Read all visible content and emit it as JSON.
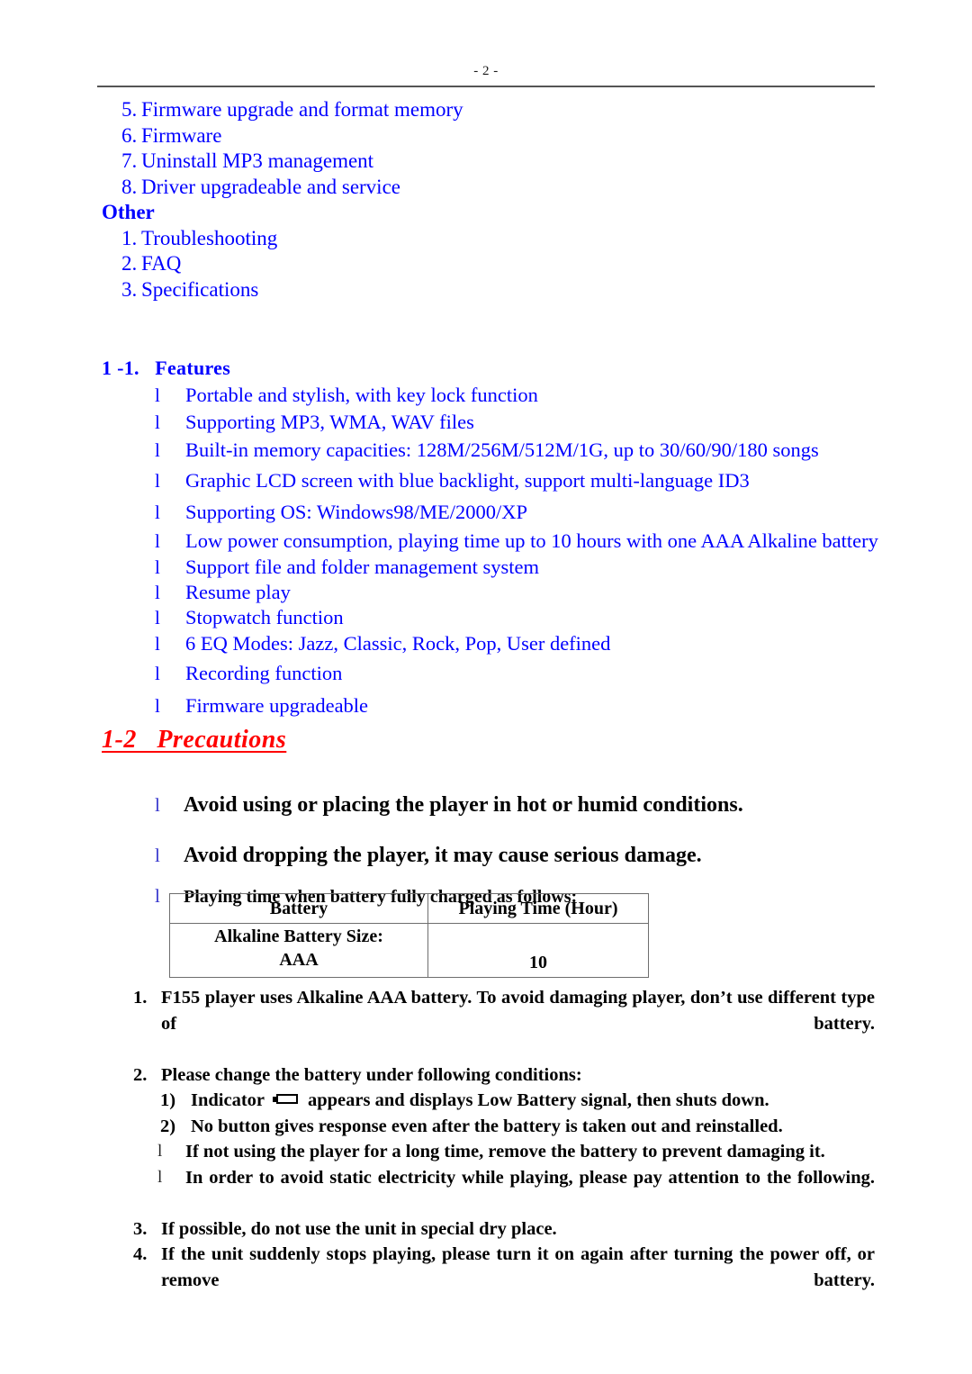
{
  "header": {
    "page_label": "- 2 -"
  },
  "toc": {
    "continued_items": [
      {
        "num": "5.",
        "text": "Firmware upgrade and format memory"
      },
      {
        "num": "6.",
        "text": "Firmware"
      },
      {
        "num": "7.",
        "text": "Uninstall MP3 management"
      },
      {
        "num": "8.",
        "text": "Driver upgradeable and service"
      }
    ],
    "other_heading": "Other",
    "other_items": [
      {
        "num": "1.",
        "text": "Troubleshooting"
      },
      {
        "num": "2.",
        "text": "FAQ"
      },
      {
        "num": "3.",
        "text": "Specifications"
      }
    ]
  },
  "features_section": {
    "heading": "1 -1.   Features",
    "bullet_glyph": "l",
    "items": [
      "Portable and stylish, with key lock function",
      "Supporting MP3, WMA, WAV files",
      "Built-in memory capacities: 128M/256M/512M/1G, up to 30/60/90/180 songs",
      "Graphic LCD screen with blue backlight, support multi-language ID3",
      "Supporting OS: Windows98/ME/2000/XP",
      "Low power consumption, playing time up to 10 hours with one AAA Alkaline battery",
      "Support file and folder management system",
      "Resume play",
      "Stopwatch function",
      "6 EQ Modes: Jazz, Classic, Rock, Pop, User defined",
      "Recording function",
      "Firmware upgradeable"
    ]
  },
  "precautions_section": {
    "heading": "1-2   Precautions",
    "warnings": [
      "Avoid using or placing the player in hot or humid conditions.",
      "Avoid dropping the player, it may cause serious damage."
    ],
    "table_intro": "Playing time when battery fully charged as follows:",
    "table": {
      "headers": [
        "Battery",
        "Playing Time (Hour)"
      ],
      "rows": [
        {
          "battery_line1": "Alkaline Battery Size:",
          "battery_line2": "AAA",
          "playing_time": "10"
        }
      ]
    },
    "numbered": [
      {
        "num": "1.",
        "text": "F155 player uses Alkaline AAA battery. To avoid damaging player, don’t use different type of battery."
      },
      {
        "num": "2.",
        "text": "Please change the battery under following conditions:"
      }
    ],
    "sub_items": [
      {
        "num": "1)",
        "text_before": "Indicator",
        "icon": "battery-icon",
        "text_after": "appears and displays Low Battery signal, then shuts down."
      },
      {
        "num": "2)",
        "text_before": "No button gives response even after the battery is taken out and reinstalled.",
        "icon": "",
        "text_after": ""
      }
    ],
    "bullet_items": [
      "If not using the player for a long time, remove the battery to prevent damaging it.",
      "In order to avoid static electricity while playing, please pay attention to the following."
    ],
    "numbered_tail": [
      {
        "num": "3.",
        "text": "If possible, do not use the unit in special dry place."
      },
      {
        "num": "4.",
        "text": "If the unit suddenly stops playing, please turn it on again after turning the power off, or remove battery."
      }
    ]
  },
  "colors": {
    "blue_text": "#0000FF",
    "red_heading": "#FF0000",
    "body_black": "#000000",
    "rule_gray": "#555555",
    "table_border": "#6E6E6E"
  }
}
